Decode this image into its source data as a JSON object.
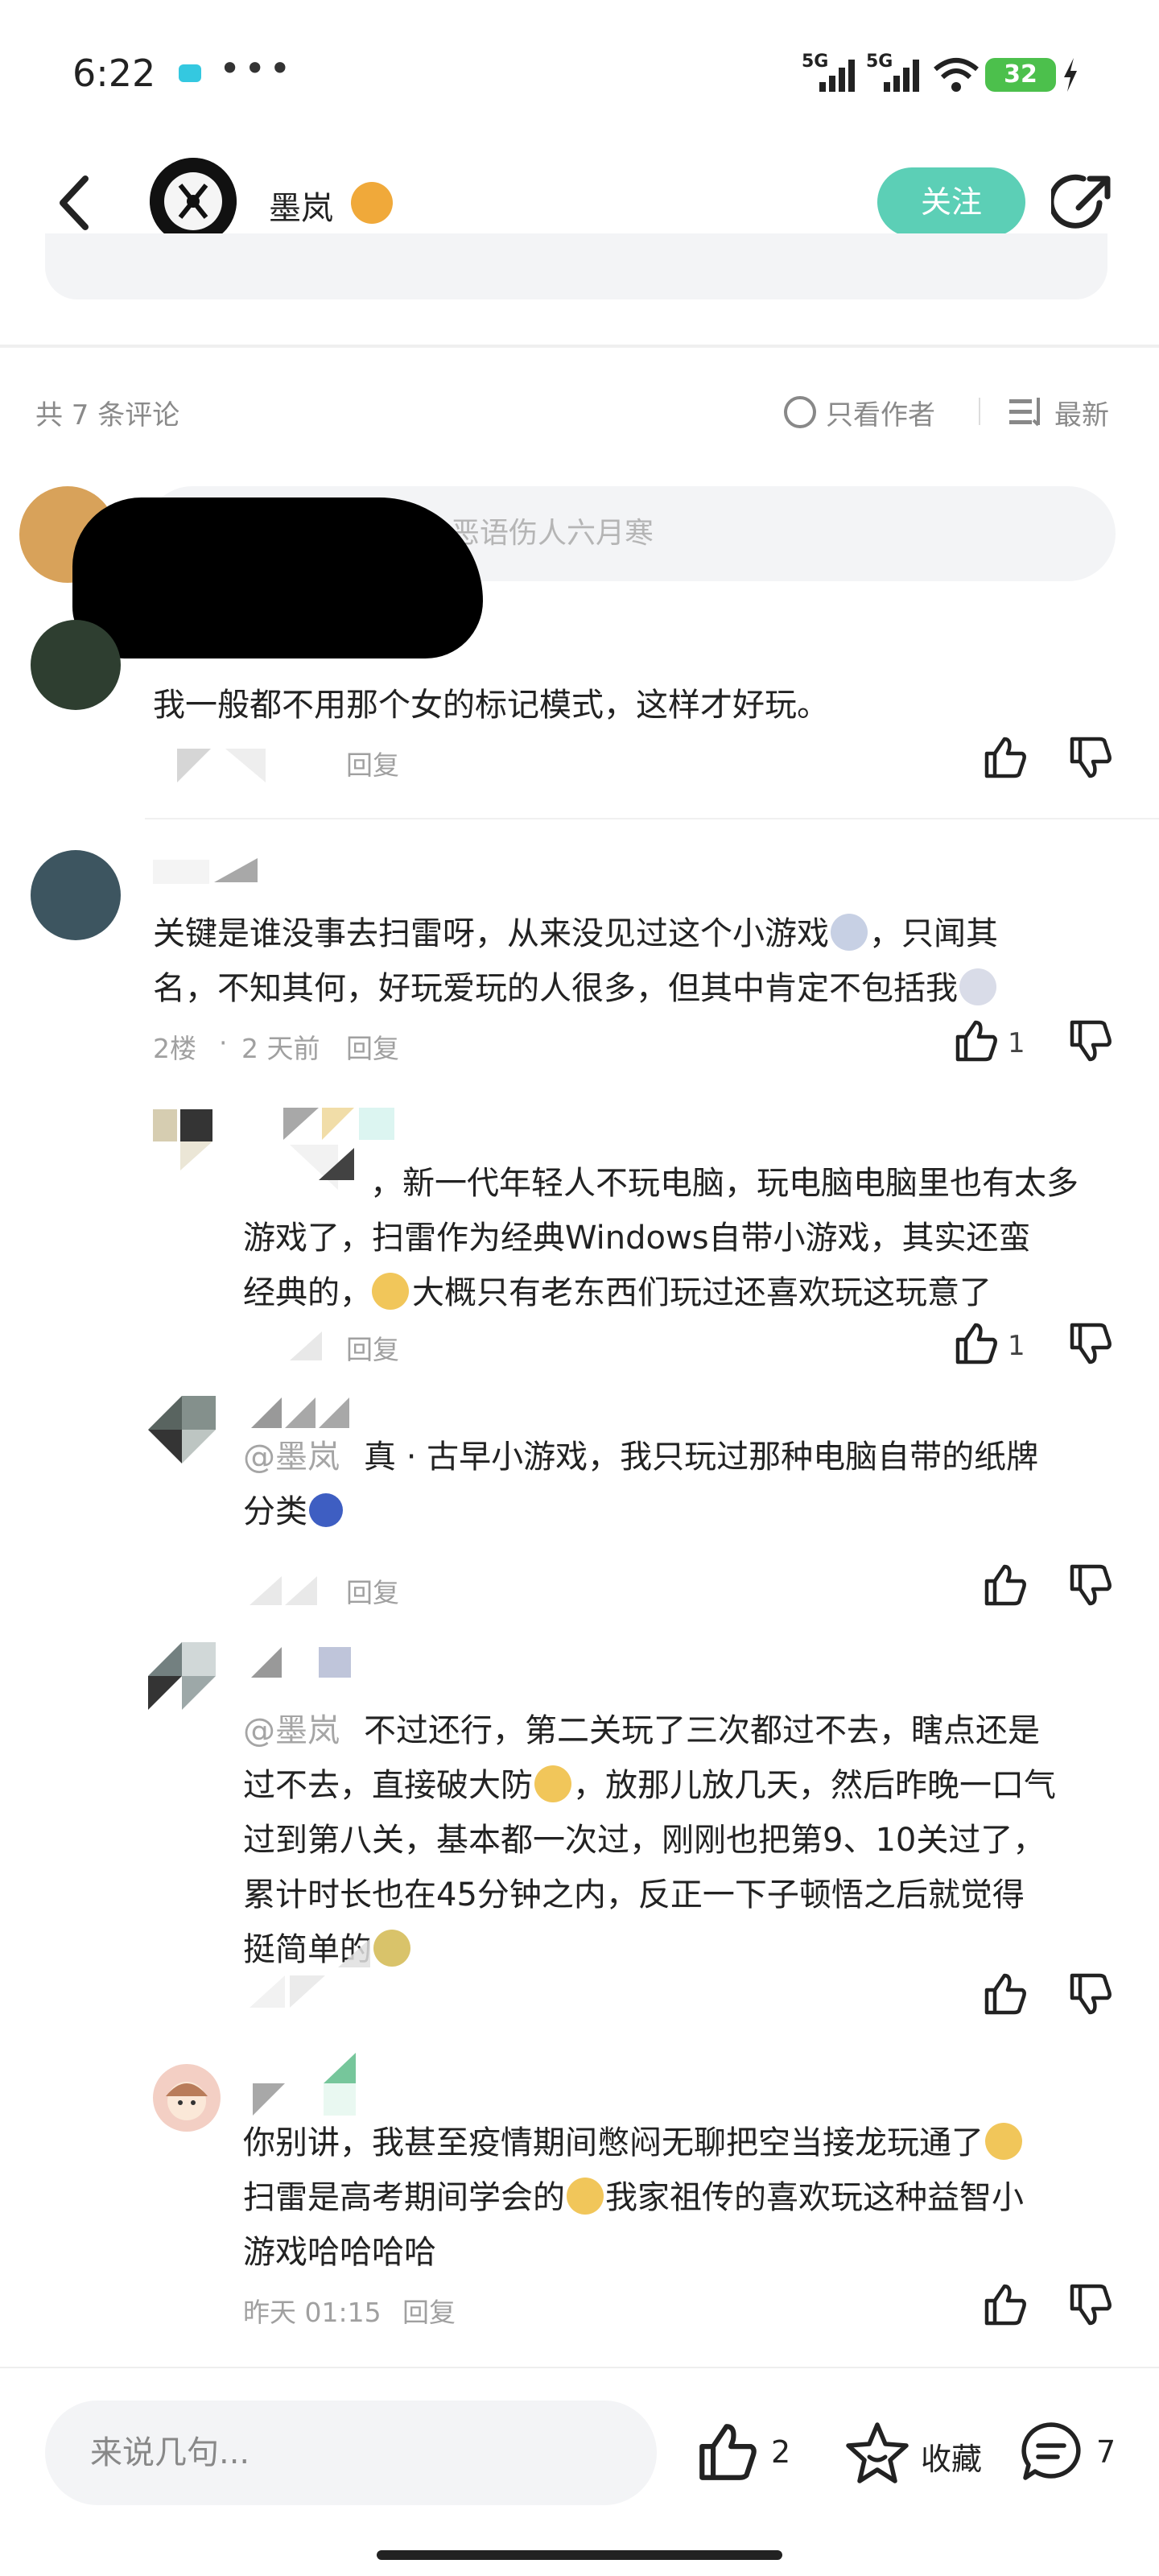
{
  "status_bar": {
    "time": "6:22",
    "dots": "•••",
    "net1": "5G",
    "net2": "5G",
    "battery": "32"
  },
  "header": {
    "author_name": "墨岚",
    "follow_label": "关注"
  },
  "comments_header": {
    "count_label": "共 7 条评论",
    "only_author": "只看作者",
    "sort_latest": "最新"
  },
  "comment_input_placeholder": "恶语伤人六月寒",
  "comments": [
    {
      "text": "我一般都不用那个女的标记模式，这样才好玩。",
      "reply": "回复"
    },
    {
      "text_line1": "关键是谁没事去扫雷呀，从来没见过这个小游戏",
      "text_line1b": "，只闻其",
      "text_line2": "名，不知其何，好玩爱玩的人很多，但其中肯定不包括我",
      "meta_floor": "2楼",
      "meta_time": "2 天前",
      "reply": "回复",
      "like_count": "1"
    }
  ],
  "replies": [
    {
      "text_line1": "，新一代年轻人不玩电脑，玩电脑电脑里也有太多",
      "text_line2": "游戏了，扫雷作为经典Windows自带小游戏，其实还蛮",
      "text_line3": "经典的，",
      "text_line3b": "大概只有老东西们玩过还喜欢玩这玩意了",
      "reply": "回复",
      "like_count": "1"
    },
    {
      "mention": "@墨岚",
      "text_line1": "真 · 古早小游戏，我只玩过那种电脑自带的纸牌",
      "text_line2": "分类",
      "reply": "回复"
    },
    {
      "mention": "@墨岚",
      "text_line1": "不过还行，第二关玩了三次都过不去，瞎点还是",
      "text_line2": "过不去，直接破大防",
      "text_line2b": "，放那儿放几天，然后昨晚一口气",
      "text_line3": "过到第八关，基本都一次过，刚刚也把第9、10关过了，",
      "text_line4": "累计时长也在45分钟之内，反正一下子顿悟之后就觉得",
      "text_line5": "挺简单的"
    },
    {
      "text_line1": "你别讲，我甚至疫情期间憋闷无聊把空当接龙玩通了",
      "text_line2": "扫雷是高考期间学会的",
      "text_line2b": "我家祖传的喜欢玩这种益智小",
      "text_line3": "游戏哈哈哈哈",
      "meta_time": "昨天 01:15",
      "reply": "回复"
    }
  ],
  "bottom_bar": {
    "input_placeholder": "来说几句...",
    "like_count": "2",
    "collect_label": "收藏",
    "comment_count": "7"
  },
  "colors": {
    "accent": "#5ccfb6",
    "battery": "#4cc04c",
    "badge": "#f0a93a"
  }
}
